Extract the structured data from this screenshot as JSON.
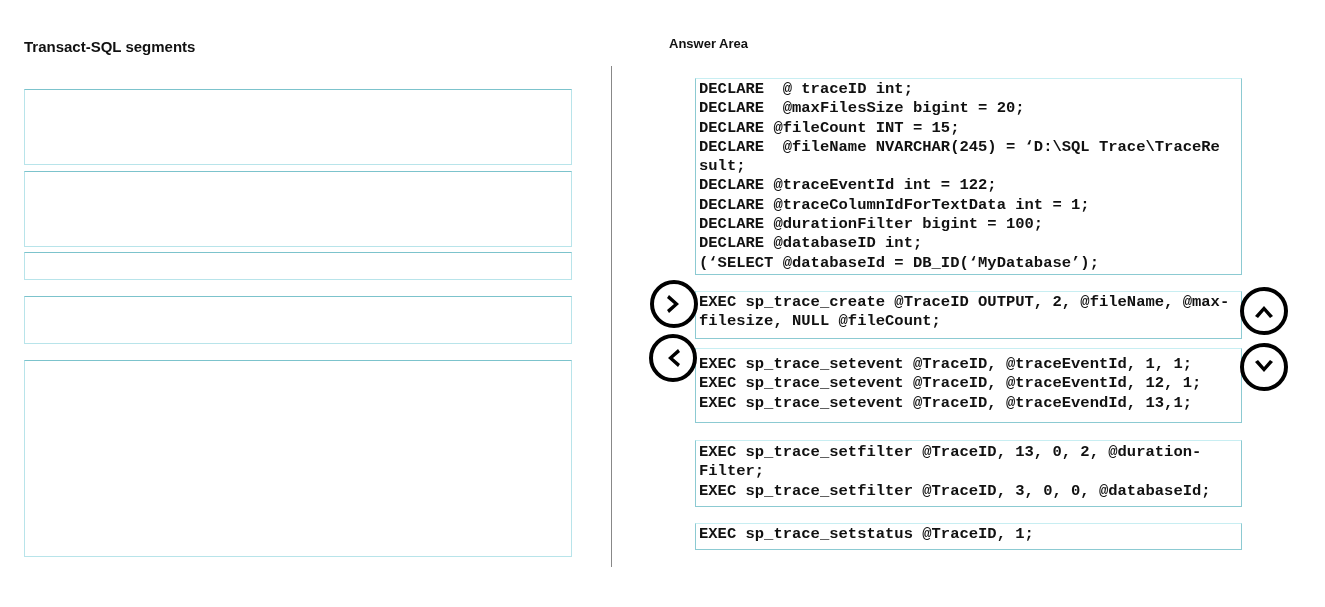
{
  "segments_panel": {
    "title": "Transact-SQL segments"
  },
  "answer_area": {
    "title": "Answer Area",
    "blocks": [
      {
        "lines": [
          "DECLARE  @ traceID int;",
          "DECLARE  @maxFilesSize bigint = 20;",
          "DECLARE @fileCount INT = 15;",
          "DECLARE  @fileName NVARCHAR(245) = ‘D:\\SQL Trace\\TraceRe",
          "sult;",
          "DECLARE @traceEventId int = 122;",
          "DECLARE @traceColumnIdForTextData int = 1;",
          "DECLARE @durationFilter bigint = 100;",
          "DECLARE @databaseID int;",
          "(‘SELECT @databaseId = DB_ID(‘MyDatabase’);"
        ]
      },
      {
        "lines": [
          "EXEC sp_trace_create @TraceID OUTPUT, 2, @fileName, @max-",
          "filesize, NULL @fileCount;"
        ]
      },
      {
        "lines": [
          "EXEC sp_trace_setevent @TraceID, @traceEventId, 1, 1;",
          "EXEC sp_trace_setevent @TraceID, @traceEventId, 12, 1;",
          "EXEC sp_trace_setevent @TraceID, @traceEvendId, 13,1;"
        ]
      },
      {
        "lines": [
          "EXEC sp_trace_setfilter @TraceID, 13, 0, 2, @duration-",
          "Filter;",
          "EXEC sp_trace_setfilter @TraceID, 3, 0, 0, @databaseId;"
        ]
      },
      {
        "lines": [
          "EXEC sp_trace_setstatus @TraceID, 1;"
        ]
      }
    ],
    "buttons": [
      {
        "kind": "right"
      },
      {
        "kind": "left"
      },
      {
        "kind": "up"
      },
      {
        "kind": "down"
      }
    ]
  }
}
